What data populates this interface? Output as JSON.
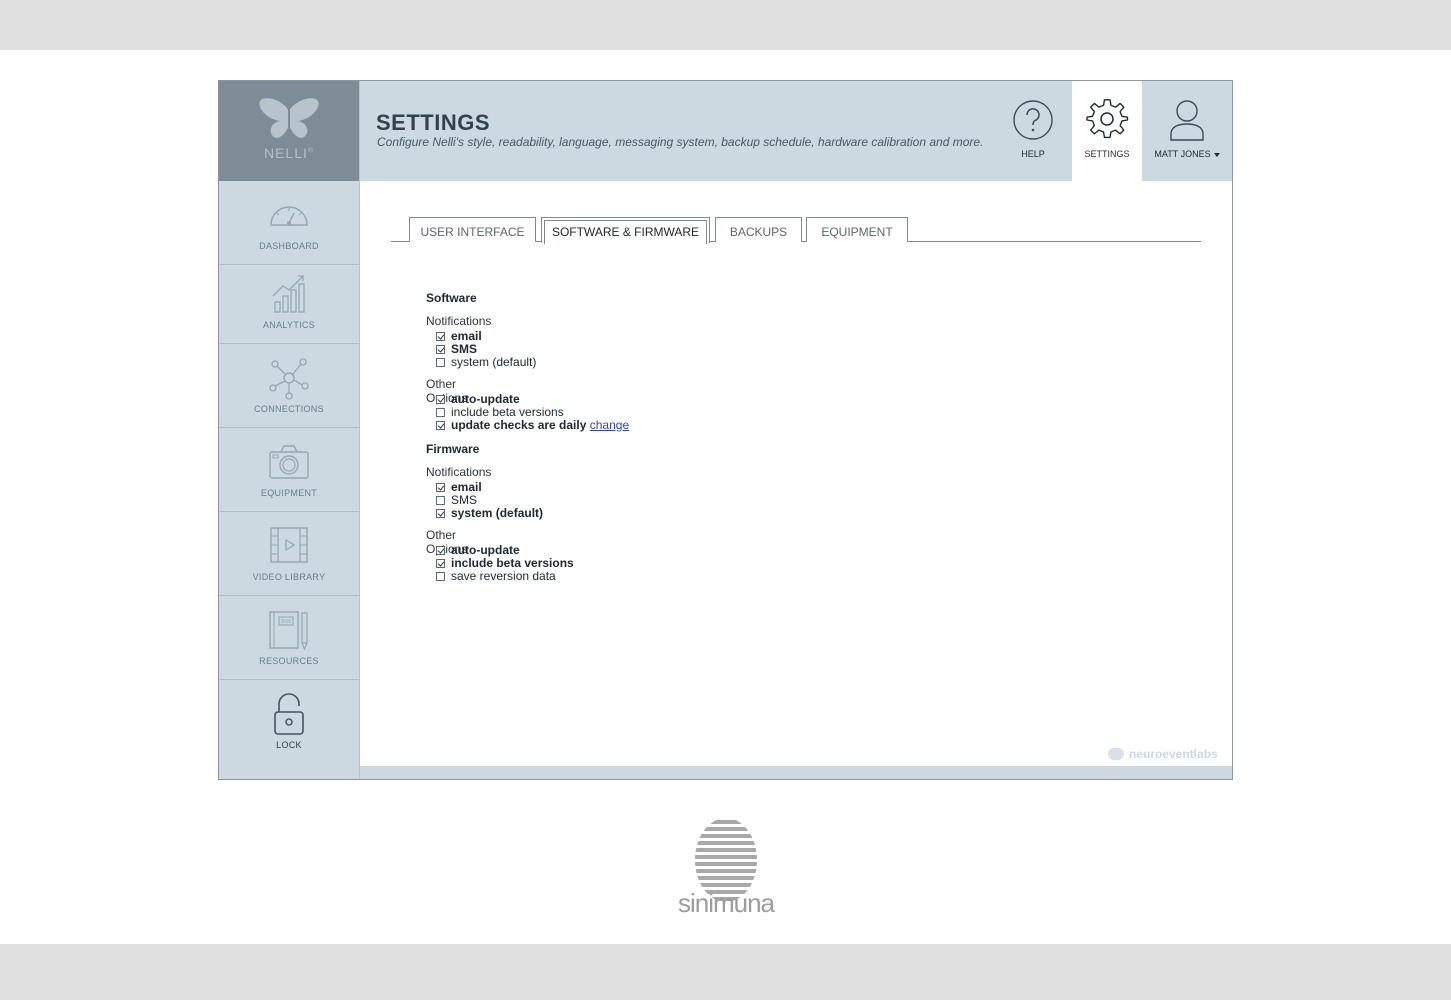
{
  "app": {
    "logo_text": "NELLI",
    "logo_mark": "®"
  },
  "sidebar": {
    "items": [
      {
        "label": "DASHBOARD",
        "icon": "speedometer-icon"
      },
      {
        "label": "ANALYTICS",
        "icon": "bar-chart-icon"
      },
      {
        "label": "CONNECTIONS",
        "icon": "network-icon"
      },
      {
        "label": "EQUIPMENT",
        "icon": "camera-icon"
      },
      {
        "label": "VIDEO LIBRARY",
        "icon": "film-icon"
      },
      {
        "label": "RESOURCES",
        "icon": "notebook-icon"
      },
      {
        "label": "LOCK",
        "icon": "padlock-icon"
      }
    ]
  },
  "header": {
    "title": "SETTINGS",
    "subtitle": "Configure Nelli's style, readability, language, messaging system, backup schedule, hardware calibration and more.",
    "help_label": "HELP",
    "settings_label": "SETTINGS",
    "user_label": "MATT JONES"
  },
  "tabs": [
    {
      "label": "USER INTERFACE",
      "active": false
    },
    {
      "label": "SOFTWARE & FIRMWARE",
      "active": true
    },
    {
      "label": "BACKUPS",
      "active": false
    },
    {
      "label": "EQUIPMENT",
      "active": false
    }
  ],
  "software": {
    "title": "Software",
    "notifications_label": "Notifications",
    "notifications": [
      {
        "label": "email",
        "checked": true
      },
      {
        "label": "SMS",
        "checked": true
      },
      {
        "label": "system (default)",
        "checked": false
      }
    ],
    "other_label": "Other Options",
    "other": [
      {
        "label": "auto-update",
        "checked": true
      },
      {
        "label": "include beta versions",
        "checked": false
      },
      {
        "label": "update checks are daily",
        "checked": true,
        "link": "change"
      }
    ]
  },
  "firmware": {
    "title": "Firmware",
    "notifications_label": "Notifications",
    "notifications": [
      {
        "label": "email",
        "checked": true
      },
      {
        "label": "SMS",
        "checked": false
      },
      {
        "label": "system (default)",
        "checked": true
      }
    ],
    "other_label": "Other Options",
    "other": [
      {
        "label": "auto-update",
        "checked": true
      },
      {
        "label": "include beta versions",
        "checked": true
      },
      {
        "label": "save reversion data",
        "checked": false
      }
    ]
  },
  "watermark": "neuroeventlabs",
  "brand": "sinimuna",
  "colors": {
    "sidebar": "#ccd9e1",
    "logo_bg": "#7d8c96",
    "link": "#2b4aa8"
  }
}
